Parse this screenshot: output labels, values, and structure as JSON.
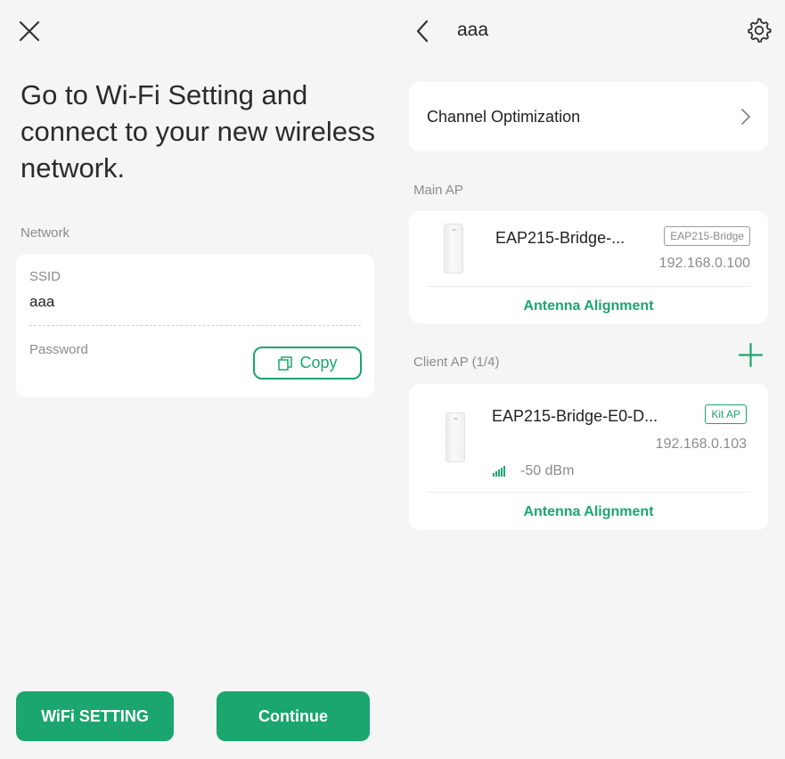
{
  "left": {
    "heading": "Go to Wi-Fi Setting and connect to your new wireless network.",
    "network_section": "Network",
    "ssid_label": "SSID",
    "ssid_value": "aaa",
    "password_label": "Password",
    "copy_label": "Copy",
    "wifi_setting_label": "WiFi SETTING",
    "continue_label": "Continue"
  },
  "right": {
    "title": "aaa",
    "channel_optimization": "Channel Optimization",
    "main_ap_section": "Main AP",
    "main_ap": {
      "name": "EAP215-Bridge-...",
      "tag": "EAP215-Bridge",
      "ip": "192.168.0.100",
      "action": "Antenna Alignment"
    },
    "client_ap_section": "Client AP (1/4)",
    "client_ap": {
      "name": "EAP215-Bridge-E0-D...",
      "tag": "Kit AP",
      "ip": "192.168.0.103",
      "signal": "-50 dBm",
      "action": "Antenna Alignment"
    }
  },
  "colors": {
    "accent": "#1aa66e",
    "background": "#f5f5f5",
    "card": "#ffffff",
    "muted_text": "#8c8c8c"
  },
  "icons": [
    "close-icon",
    "copy-icon",
    "back-icon",
    "gear-icon",
    "chevron-right-icon",
    "plus-icon",
    "signal-icon"
  ]
}
